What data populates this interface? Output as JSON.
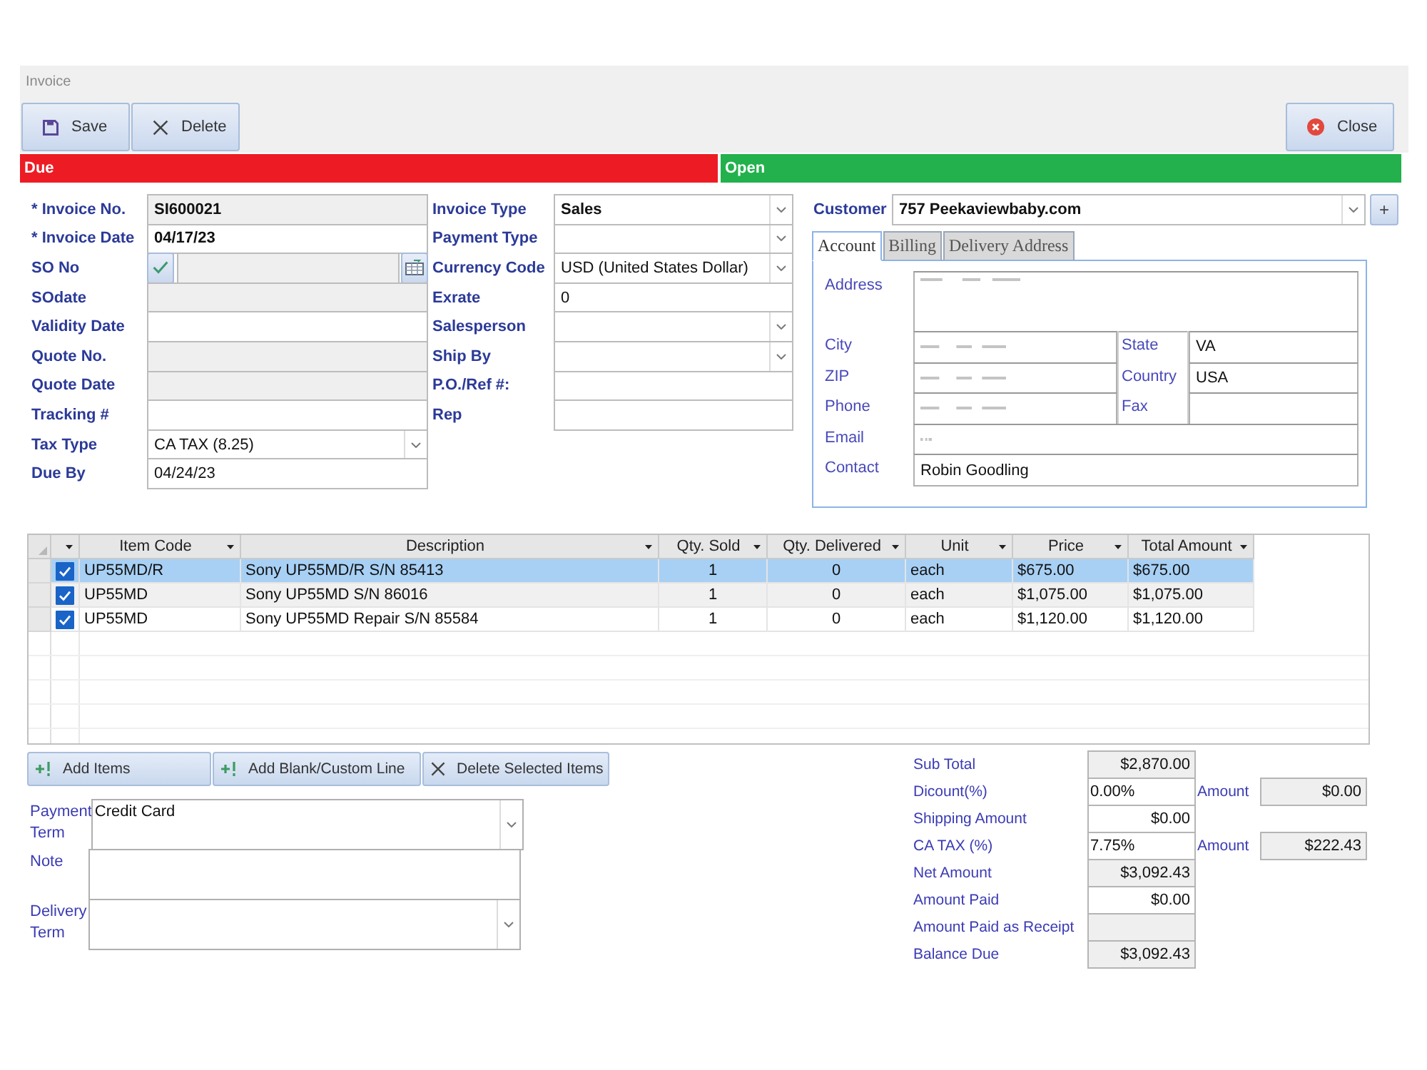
{
  "window": {
    "title": "Invoice"
  },
  "toolbar": {
    "buttons": [
      {
        "label": "Save",
        "kind": "save"
      },
      {
        "label": "Delete",
        "kind": "delete"
      }
    ],
    "close_button": {
      "label": "Close"
    }
  },
  "status": [
    {
      "label": "Due",
      "color": "#ed1c24"
    },
    {
      "label": "Open",
      "color": "#22b14c"
    }
  ],
  "fields_left": [
    {
      "label": "* Invoice No.",
      "value": "SI600021",
      "kind": "text",
      "readonly": true,
      "emphasized": true
    },
    {
      "label": "* Invoice Date",
      "value": "04/17/23",
      "kind": "text",
      "readonly": false,
      "emphasized": true
    },
    {
      "label": "SO No",
      "kind": "lookup",
      "readonly": true
    },
    {
      "label": "SOdate",
      "kind": "text",
      "readonly": true
    },
    {
      "label": "Validity Date",
      "kind": "text",
      "readonly": false
    },
    {
      "label": "Quote No.",
      "kind": "text",
      "readonly": true
    },
    {
      "label": "Quote Date",
      "kind": "text",
      "readonly": true
    },
    {
      "label": "Tracking #",
      "kind": "text",
      "readonly": false
    },
    {
      "label": "Tax Type",
      "value": "CA TAX (8.25)",
      "kind": "dropdown",
      "readonly": false,
      "emphasized": false
    },
    {
      "label": "Due By",
      "value": "04/24/23",
      "kind": "text",
      "readonly": false,
      "emphasized": false
    }
  ],
  "fields_middle": [
    {
      "label": "Invoice Type",
      "value": "Sales",
      "kind": "dropdown",
      "readonly": false,
      "emphasized": true
    },
    {
      "label": "Payment Type",
      "kind": "dropdown",
      "readonly": false
    },
    {
      "label": "Currency Code",
      "value": "USD (United States Dollar)",
      "kind": "dropdown",
      "readonly": false,
      "emphasized": false
    },
    {
      "label": "Exrate",
      "value": "0",
      "kind": "text",
      "readonly": false,
      "emphasized": false
    },
    {
      "label": "Salesperson",
      "kind": "dropdown",
      "readonly": false
    },
    {
      "label": "Ship By",
      "kind": "dropdown",
      "readonly": false
    },
    {
      "label": "P.O./Ref #:",
      "kind": "text",
      "readonly": false
    },
    {
      "label": "Rep",
      "kind": "text",
      "readonly": false
    }
  ],
  "customer": {
    "label": "Customer",
    "value": "757 Peekaviewbaby.com",
    "add_button": "+"
  },
  "tabs": [
    {
      "label": "Account",
      "selected": true
    },
    {
      "label": "Billing",
      "selected": false
    },
    {
      "label": "Delivery Address",
      "selected": false
    }
  ],
  "account": [
    {
      "kind": "multiline",
      "label": "Address",
      "redacted": true
    },
    {
      "kind": "pair",
      "label": "City",
      "redacted": true,
      "pair": {
        "label": "State",
        "value": "VA"
      }
    },
    {
      "kind": "pair",
      "label": "ZIP",
      "redacted": true,
      "pair": {
        "label": "Country",
        "value": "USA"
      }
    },
    {
      "kind": "pair",
      "label": "Phone",
      "redacted": true,
      "pair": {
        "label": "Fax"
      }
    },
    {
      "kind": "single",
      "label": "Email",
      "redacted": true
    },
    {
      "kind": "single",
      "label": "Contact",
      "value": "Robin Goodling",
      "redacted": false
    }
  ],
  "table": {
    "columns": [
      {
        "label": "Item Code",
        "kind": "text"
      },
      {
        "label": "Description",
        "kind": "text"
      },
      {
        "label": "Qty. Sold",
        "kind": "quantity"
      },
      {
        "label": "Qty. Delivered",
        "kind": "quantity"
      },
      {
        "label": "Unit",
        "kind": "text"
      },
      {
        "label": "Price",
        "kind": "money"
      },
      {
        "label": "Total Amount",
        "kind": "money"
      }
    ],
    "rows": [
      {
        "selected": true,
        "checked": true,
        "cells": [
          "UP55MD/R",
          "Sony UP55MD/R S/N 85413",
          "1",
          "0",
          "each",
          "$675.00",
          "$675.00"
        ]
      },
      {
        "selected": false,
        "checked": true,
        "cells": [
          "UP55MD",
          "Sony UP55MD S/N 86016",
          "1",
          "0",
          "each",
          "$1,075.00",
          "$1,075.00"
        ]
      },
      {
        "selected": false,
        "checked": true,
        "cells": [
          "UP55MD",
          "Sony UP55MD Repair S/N 85584",
          "1",
          "0",
          "each",
          "$1,120.00",
          "$1,120.00"
        ]
      }
    ]
  },
  "line_buttons": [
    {
      "label": "Add Items",
      "kind": "add"
    },
    {
      "label": "Add Blank/Custom Line",
      "kind": "add"
    },
    {
      "label": "Delete Selected Items",
      "kind": "delete"
    }
  ],
  "terms": [
    {
      "label": "Payment Term",
      "value": "Credit Card",
      "kind": "dropdown"
    },
    {
      "label": "Note",
      "kind": "multiline"
    },
    {
      "label": "Delivery Term",
      "kind": "dropdown"
    }
  ],
  "totals": [
    {
      "label": "Sub Total",
      "value": "$2,870.00",
      "kind": "money",
      "readonly": true
    },
    {
      "label": "Dicount(%)",
      "value": "0.00%",
      "kind": "percent",
      "readonly": false,
      "amount": {
        "label": "Amount",
        "value": "$0.00"
      }
    },
    {
      "label": "Shipping Amount",
      "value": "$0.00",
      "kind": "money",
      "readonly": false
    },
    {
      "label": "CA TAX (%)",
      "value": "7.75%",
      "kind": "percent",
      "readonly": false,
      "amount": {
        "label": "Amount",
        "value": "$222.43"
      }
    },
    {
      "label": "Net Amount",
      "value": "$3,092.43",
      "kind": "money",
      "readonly": true
    },
    {
      "label": "Amount Paid",
      "value": "$0.00",
      "kind": "money",
      "readonly": false
    },
    {
      "label": "Amount Paid as Receipt",
      "kind": "money",
      "readonly": true
    },
    {
      "label": "Balance Due",
      "value": "$3,092.43",
      "kind": "money",
      "readonly": true
    }
  ]
}
